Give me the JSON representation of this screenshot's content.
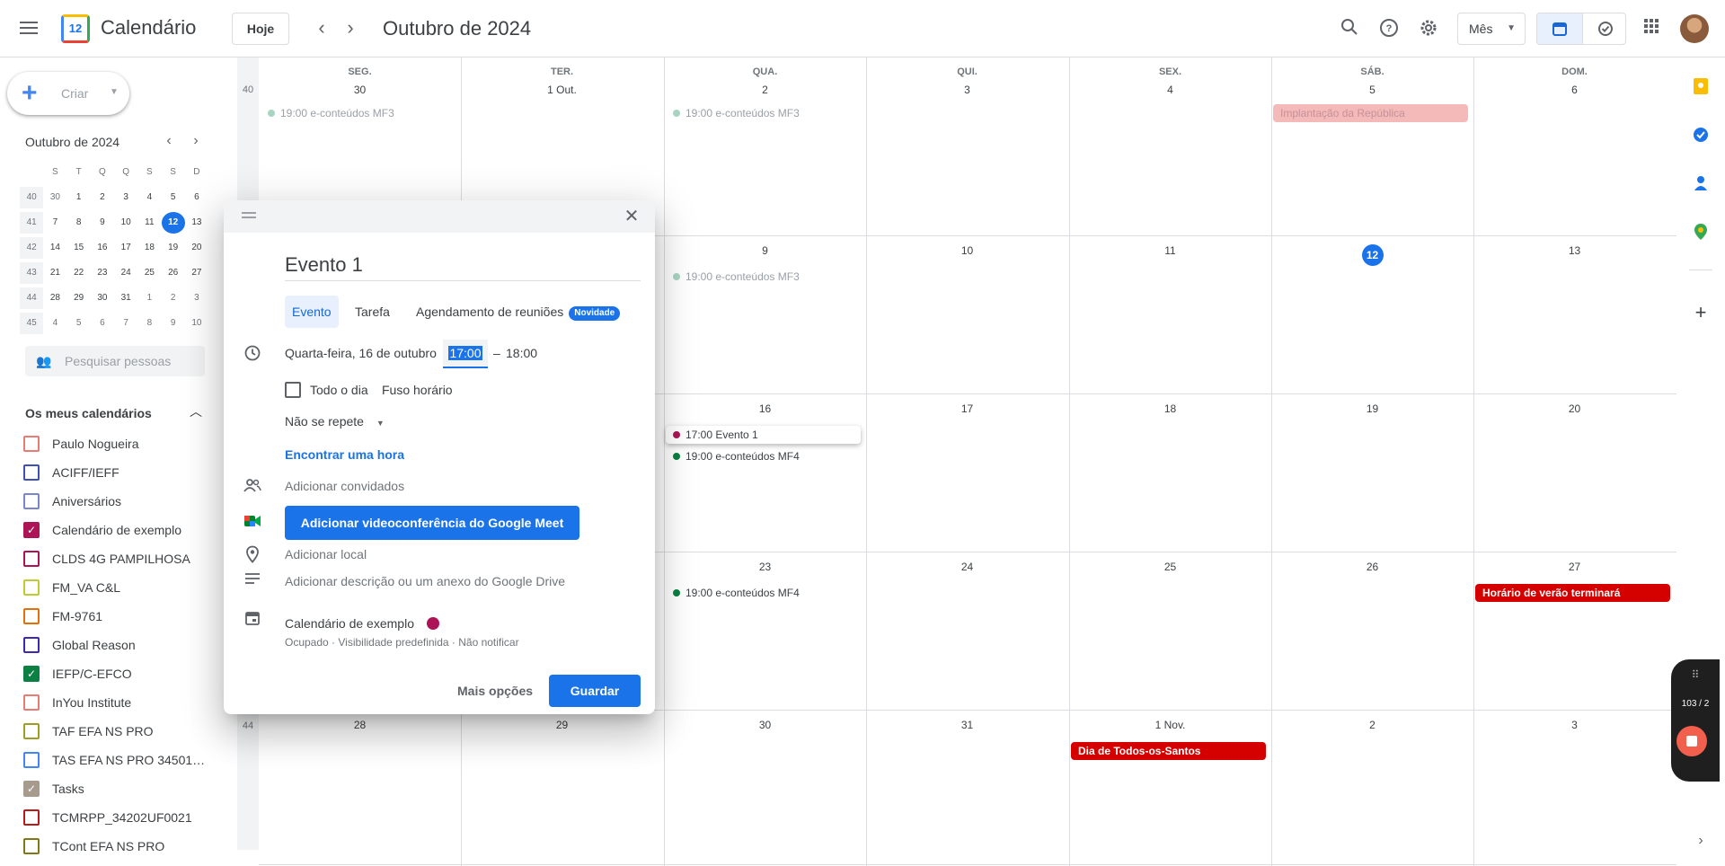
{
  "header": {
    "app_name": "Calendário",
    "logo_day": "12",
    "today_label": "Hoje",
    "prev_icon": "‹",
    "next_icon": "›",
    "title": "Outubro de 2024",
    "view_label": "Mês"
  },
  "sidebar": {
    "create_label": "Criar",
    "mini_title": "Outubro de 2024",
    "weekday_heads": [
      "S",
      "T",
      "Q",
      "Q",
      "S",
      "S",
      "D"
    ],
    "mini_weeks": [
      {
        "wk": "40",
        "days": [
          "30",
          "1",
          "2",
          "3",
          "4",
          "5",
          "6"
        ]
      },
      {
        "wk": "41",
        "days": [
          "7",
          "8",
          "9",
          "10",
          "11",
          "12",
          "13"
        ]
      },
      {
        "wk": "42",
        "days": [
          "14",
          "15",
          "16",
          "17",
          "18",
          "19",
          "20"
        ]
      },
      {
        "wk": "43",
        "days": [
          "21",
          "22",
          "23",
          "24",
          "25",
          "26",
          "27"
        ]
      },
      {
        "wk": "44",
        "days": [
          "28",
          "29",
          "30",
          "31",
          "1",
          "2",
          "3"
        ]
      },
      {
        "wk": "45",
        "days": [
          "4",
          "5",
          "6",
          "7",
          "8",
          "9",
          "10"
        ]
      }
    ],
    "search_people_placeholder": "Pesquisar pessoas",
    "my_calendars_title": "Os meus calendários",
    "calendars": [
      {
        "name": "Paulo Nogueira",
        "color": "#e67c73",
        "checked": false
      },
      {
        "name": "ACIFF/IEFF",
        "color": "#3f51b5",
        "checked": false
      },
      {
        "name": "Aniversários",
        "color": "#7986cb",
        "checked": false
      },
      {
        "name": "Calendário de exemplo",
        "color": "#ad1457",
        "checked": true
      },
      {
        "name": "CLDS 4G PAMPILHOSA",
        "color": "#ad1457",
        "checked": false
      },
      {
        "name": "FM_VA C&L",
        "color": "#c0ca33",
        "checked": false
      },
      {
        "name": "FM-9761",
        "color": "#e4700b",
        "checked": false
      },
      {
        "name": "Global Reason",
        "color": "#3f28b2",
        "checked": false
      },
      {
        "name": "IEFP/C-EFCO",
        "color": "#0b8043",
        "checked": true
      },
      {
        "name": "InYou Institute",
        "color": "#e67c73",
        "checked": false
      },
      {
        "name": "TAF EFA NS PRO",
        "color": "#9e9d24",
        "checked": false
      },
      {
        "name": "TAS EFA NS PRO 34501UF…",
        "color": "#4285f4",
        "checked": false
      },
      {
        "name": "Tasks",
        "color": "#a79b8e",
        "checked": true
      },
      {
        "name": "TCMRPP_34202UF0021",
        "color": "#b71c1c",
        "checked": false
      },
      {
        "name": "TCont EFA NS PRO",
        "color": "#827717",
        "checked": false
      }
    ]
  },
  "month": {
    "day_heads": [
      "SEG.",
      "TER.",
      "QUA.",
      "QUI.",
      "SEX.",
      "SÁB.",
      "DOM."
    ],
    "weeks": [
      {
        "wk": "40",
        "days": [
          "30",
          "1 Out.",
          "2",
          "3",
          "4",
          "5",
          "6"
        ]
      },
      {
        "wk": "",
        "days": [
          "",
          "",
          "9",
          "10",
          "11",
          "12",
          "13"
        ]
      },
      {
        "wk": "",
        "days": [
          "",
          "",
          "16",
          "17",
          "18",
          "19",
          "20"
        ]
      },
      {
        "wk": "",
        "days": [
          "",
          "",
          "23",
          "24",
          "25",
          "26",
          "27"
        ]
      },
      {
        "wk": "44",
        "days": [
          "28",
          "29",
          "30",
          "31",
          "1 Nov.",
          "2",
          "3"
        ]
      }
    ],
    "events": [
      {
        "text": "19:00 e-conteúdos MF3",
        "week": 0,
        "day": 0,
        "style": "dot-faded",
        "color": "#a8d5c2"
      },
      {
        "text": "19:00 e-conteúdos MF3",
        "week": 0,
        "day": 2,
        "style": "dot-faded",
        "color": "#a8d5c2"
      },
      {
        "text": "Implantação da República",
        "week": 0,
        "day": 5,
        "style": "block-faded",
        "color": "#f4b9b9"
      },
      {
        "text": "19:00 e-conteúdos MF3",
        "week": 1,
        "day": 2,
        "style": "dot-faded",
        "color": "#a8d5c2"
      },
      {
        "text": "17:00 Evento 1",
        "week": 2,
        "day": 2,
        "style": "dot-selected",
        "color": "#ad1457"
      },
      {
        "text": "19:00 e-conteúdos MF4",
        "week": 2,
        "day": 2,
        "style": "dot",
        "color": "#0b8043"
      },
      {
        "text": "19:00 e-conteúdos MF4",
        "week": 3,
        "day": 2,
        "style": "dot",
        "color": "#0b8043"
      },
      {
        "text": "Horário de verão terminará",
        "week": 3,
        "day": 6,
        "style": "block",
        "color": "#d50000"
      },
      {
        "text": "Dia de Todos-os-Santos",
        "week": 4,
        "day": 4,
        "style": "block",
        "color": "#d50000"
      }
    ]
  },
  "dialog": {
    "title_value": "Evento 1",
    "tabs": [
      "Evento",
      "Tarefa",
      "Agendamento de reuniões"
    ],
    "badge": "Novidade",
    "date_text": "Quarta-feira, 16 de outubro",
    "start_time": "17:00",
    "dash": "–",
    "end_time": "18:00",
    "all_day": "Todo o dia",
    "timezone": "Fuso horário",
    "repeat": "Não se repete",
    "find_time": "Encontrar uma hora",
    "add_guests": "Adicionar convidados",
    "meet_button": "Adicionar videoconferência do Google Meet",
    "add_location": "Adicionar local",
    "add_description": "Adicionar descrição ou um anexo do Google Drive",
    "calendar_name": "Calendário de exemplo",
    "calendar_meta": "Ocupado · Visibilidade predefinida · Não notificar",
    "more_options": "Mais opções",
    "save": "Guardar"
  },
  "overlay": {
    "counter": "103 / 2"
  }
}
